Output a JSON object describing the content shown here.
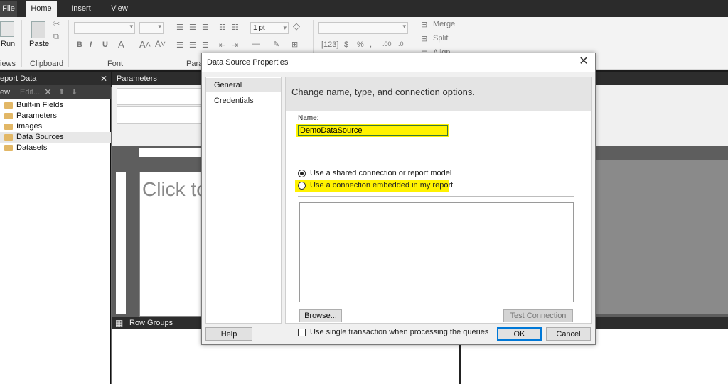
{
  "ribbon": {
    "tabs": [
      "File",
      "Home",
      "Insert",
      "View"
    ],
    "active_tab": "Home",
    "run_label": "Run",
    "views_label": "iews",
    "paste_label": "Paste",
    "clipboard_label": "Clipboard",
    "font_label": "Font",
    "paragraph_label": "Para",
    "border_size": "1 pt",
    "merge_label": "Merge",
    "split_label": "Split",
    "align_label": "Align"
  },
  "report_data": {
    "title": "eport Data",
    "toolbar_new": "ew",
    "toolbar_edit": "Edit...",
    "items": [
      {
        "label": "Built-in Fields"
      },
      {
        "label": "Parameters"
      },
      {
        "label": "Images"
      },
      {
        "label": "Data Sources"
      },
      {
        "label": "Datasets"
      }
    ],
    "selected": "Data Sources"
  },
  "parameters_header": "Parameters",
  "canvas_placeholder": "Click to",
  "row_groups_label": "Row Groups",
  "dialog": {
    "title": "Data Source Properties",
    "nav": [
      {
        "label": "General"
      },
      {
        "label": "Credentials"
      }
    ],
    "nav_selected": "General",
    "heading": "Change name, type, and connection options.",
    "name_label": "Name:",
    "name_value": "DemoDataSource",
    "radio_shared": "Use a shared connection or report model",
    "radio_embedded": "Use a connection embedded in my report",
    "browse_button": "Browse...",
    "test_connection_button": "Test Connection",
    "single_transaction": "Use single transaction when processing the queries",
    "help_button": "Help",
    "ok_button": "OK",
    "cancel_button": "Cancel"
  },
  "colors": {
    "highlight": "#fff200",
    "dark_header": "#2d2d2d",
    "accent": "#0078d7"
  }
}
